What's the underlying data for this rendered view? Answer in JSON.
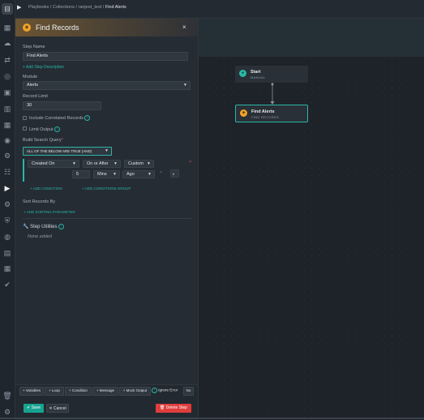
{
  "breadcrumb": {
    "parts": [
      "Playbooks",
      "Collections",
      "ranjeet_test"
    ],
    "separator": "/",
    "current": "Find Alerts"
  },
  "panel": {
    "title": "Find Records",
    "close_glyph": "×",
    "step_name_label": "Step Name",
    "step_name_value": "Find Alerts",
    "add_description": "+ Add Step Description",
    "module_label": "Module",
    "module_value": "Alerts",
    "record_limit_label": "Record Limit",
    "record_limit_value": "30",
    "include_correlated": "Include Correlated Records",
    "limit_output": "Limit Output",
    "build_query_label": "Build Search Query",
    "build_query_required": "*",
    "logic_value": "ALL OF THE BELOW ARE TRUE (AND)",
    "condition": {
      "field": "Created On",
      "operator": "On or After",
      "mode": "Custom",
      "amount": "5",
      "unit": "Mins",
      "direction": "Ago",
      "clear_glyph": "×",
      "remove_glyph": "×",
      "pause_glyph": "II"
    },
    "add_condition": "+ ADD CONDITION",
    "add_conditions_group": "+ ADD CONDITIONS GROUP",
    "sort_label": "Sort Records By",
    "add_sorting": "+ ADD SORTING PARAMETER",
    "step_utilities": "Step Utilities",
    "none_added": "None added"
  },
  "footer": {
    "buttons": [
      "+ Variables",
      "+ Loop",
      "+ Condition",
      "+ Message",
      "+ Mock Output"
    ],
    "ignore_error": "Ignore Error",
    "ignore_value": "No",
    "save": "Save",
    "cancel": "Cancel",
    "delete": "Delete Step"
  },
  "canvas": {
    "start": {
      "title": "Start",
      "subtitle": "MANUAL"
    },
    "find_alerts": {
      "title": "Find Alerts",
      "subtitle": "FIND RECORDS"
    }
  },
  "colors": {
    "accent": "#2bb6a7",
    "delete": "#e03d3d",
    "step_icon": "#f0a32a",
    "start_icon": "#2bb6a7"
  }
}
